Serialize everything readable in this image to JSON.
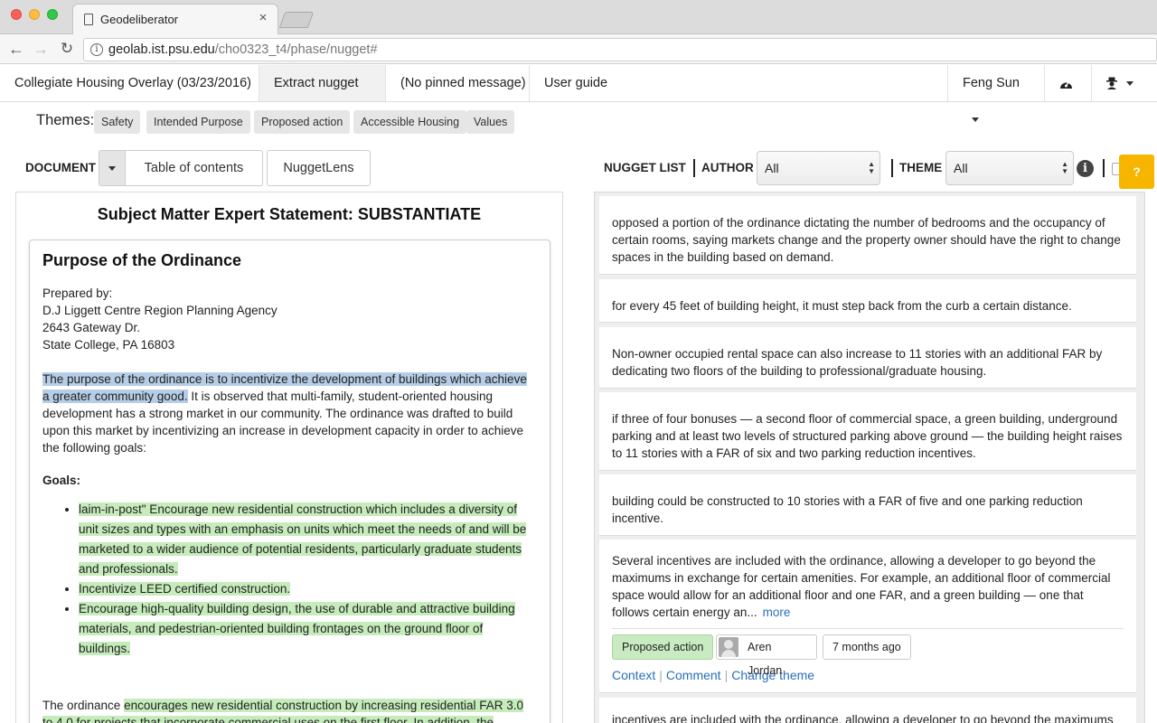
{
  "browser": {
    "tab_title": "Geodeliberator",
    "tab_close": "×",
    "url_host": "geolab.ist.psu.edu",
    "url_path": "/cho0323_t4/phase/nugget#"
  },
  "appnav": {
    "doc_name": "Collegiate Housing Overlay (03/23/2016)",
    "extract": "Extract nugget",
    "pinned": "(No pinned message)",
    "guide": "User guide",
    "user": "Feng Sun"
  },
  "themes": {
    "label": "Themes:",
    "chips": [
      "Safety",
      "Intended Purpose",
      "Proposed action",
      "Accessible Housing",
      "Values"
    ]
  },
  "doc_toolbar": {
    "label": "DOCUMENT",
    "toc": "Table of contents",
    "lens": "NuggetLens"
  },
  "nugget_toolbar": {
    "label": "NUGGET LIST",
    "author_label": "AUTHOR",
    "author_value": "All",
    "theme_label": "THEME",
    "theme_value": "All",
    "help": "?"
  },
  "document": {
    "title": "Subject Matter Expert Statement: SUBSTANTIATE",
    "heading": "Purpose of the Ordinance",
    "prepared_lines": [
      "Prepared by:",
      "D.J Liggett Centre Region Planning Agency",
      "2643 Gateway Dr.",
      "State College, PA 16803"
    ],
    "para1_hl": "The purpose of the ordinance is to incentivize the development of buildings which achieve a greater community good.",
    "para1_rest": " It is observed that multi-family, student-oriented housing development has a strong market in our community. The ordinance was drafted to build upon this market by incentivizing an increase in development capacity in order to achieve the following goals:",
    "goals_heading": "Goals:",
    "goals": [
      "laim-in-post\" Encourage new residential construction which includes a diversity of unit sizes and types with an emphasis on units which meet the needs of and will be marketed to a wider audience of potential residents, particularly graduate students and professionals.",
      "Incentivize LEED certified construction.",
      "Encourage high-quality building design, the use of durable and attractive building materials, and pedestrian-oriented building frontages on the ground floor of buildings."
    ],
    "para2_plain": "The ordinance ",
    "para2_hl": "encourages new residential construction by increasing residential FAR 3.0 to 4.0 for projects that incorporate commercial uses on the first floor. In addition, the"
  },
  "nuggets": [
    {
      "text": "opposed a portion of the ordinance dictating the number of bedrooms and the occupancy of certain rooms, saying markets change and the property owner should have the right to change spaces in the building based on demand."
    },
    {
      "text": "for every 45 feet of building height, it must step back from the curb a certain distance."
    },
    {
      "text": "Non-owner occupied rental space can also increase to 11 stories with an additional FAR by dedicating two floors of the building to professional/graduate housing."
    },
    {
      "text": "if three of four bonuses — a second floor of commercial space, a green building, underground parking and at least two levels of structured parking above ground — the building height raises to 11 stories with a FAR of six and two parking reduction incentives."
    },
    {
      "text": "building could be constructed to 10 stories with a FAR of five and one parking reduction incentive."
    },
    {
      "text": "Several incentives are included with the ordinance, allowing a developer to go beyond the maximums in exchange for certain amenities. For example, an additional floor of commercial space would allow for an additional floor and one FAR, and a green building — one that follows certain energy an...",
      "more": "more",
      "theme": "Proposed action",
      "author": "Aren Jordan",
      "time": "7 months ago",
      "actions": [
        "Context",
        "Comment",
        "Change theme"
      ]
    },
    {
      "text": "incentives are included with the ordinance, allowing a developer to go beyond the maximums"
    }
  ]
}
